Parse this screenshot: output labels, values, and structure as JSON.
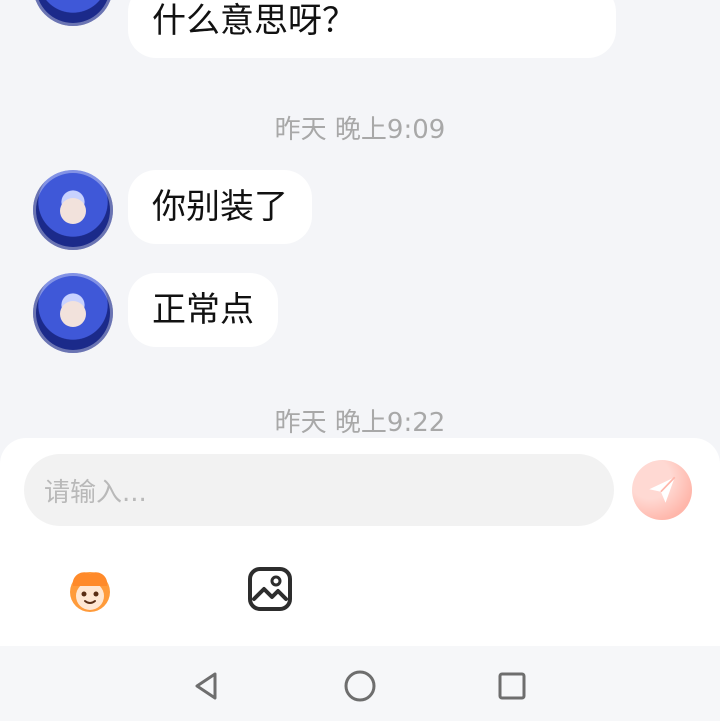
{
  "chat": {
    "messages": [
      {
        "text": "什么意思呀？"
      },
      {
        "text": "你别装了"
      },
      {
        "text": "正常点"
      }
    ],
    "timestamps": [
      {
        "text": "昨天 晚上9:09"
      },
      {
        "text": "昨天 晚上9:22"
      }
    ]
  },
  "composer": {
    "placeholder": "请输入...",
    "send_icon": "send-icon",
    "tools": [
      {
        "icon": "emoji-sticker-icon"
      },
      {
        "icon": "image-icon"
      }
    ]
  },
  "system_nav": {
    "back_icon": "back-triangle-icon",
    "home_icon": "home-circle-icon",
    "recents_icon": "recents-square-icon"
  },
  "colors": {
    "background": "#f4f5f8",
    "bubble": "#ffffff",
    "timestamp_text": "#a8a8a8",
    "send_button": "#ffb6aa"
  }
}
